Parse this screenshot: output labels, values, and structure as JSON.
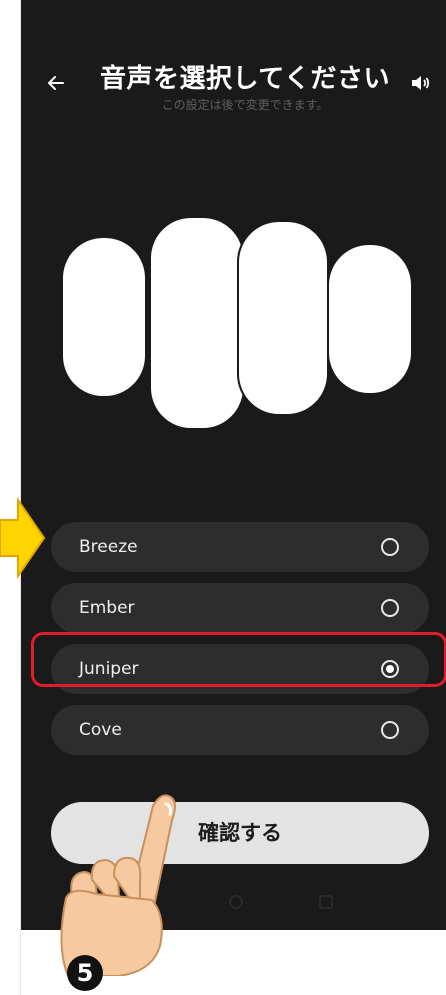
{
  "header": {
    "back_icon": "arrow-left-icon",
    "title": "音声を選択してください",
    "subtitle": "この設定は後で変更できます。",
    "speaker_icon": "speaker-icon"
  },
  "voice_options": [
    {
      "label": "Breeze",
      "selected": false
    },
    {
      "label": "Ember",
      "selected": false
    },
    {
      "label": "Juniper",
      "selected": true
    },
    {
      "label": "Cove",
      "selected": false
    }
  ],
  "confirm_button": {
    "label": "確認する"
  },
  "annotations": {
    "step_number": "❺",
    "arrow_color": "#ffd400",
    "highlight_color": "#e11c2b"
  }
}
